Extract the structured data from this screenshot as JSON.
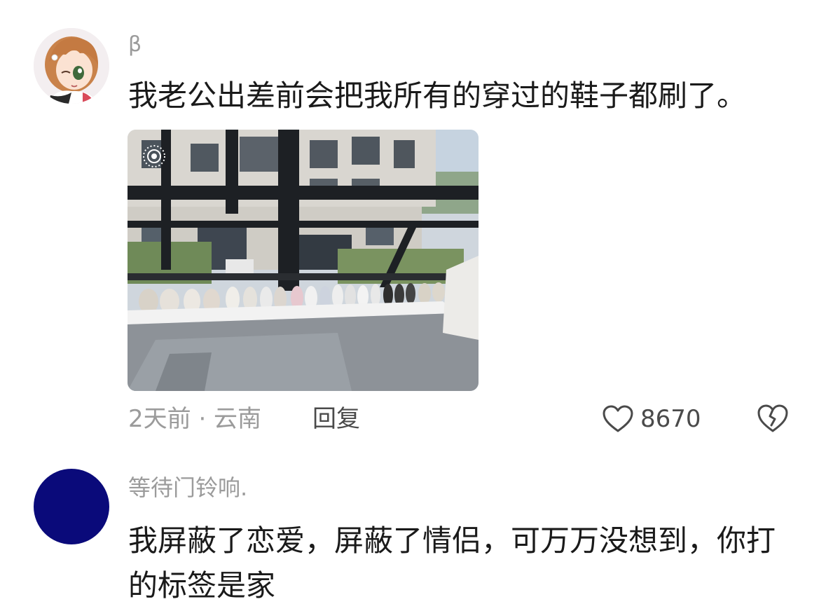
{
  "comments": [
    {
      "username": "β",
      "text": "我老公出差前会把我所有的穿过的鞋子都刷了。",
      "time_location": "2天前 · 云南",
      "reply_label": "回复",
      "likes": "8670",
      "has_photo": true
    },
    {
      "username": "等待门铃响.",
      "text": "我屏蔽了恋爱，屏蔽了情侣，可万万没想到，你打的标签是家"
    }
  ],
  "icons": {
    "like": "heart-outline-icon",
    "dislike": "broken-heart-icon"
  },
  "colors": {
    "username": "#9b9b9b",
    "body_text": "#1a1a1a",
    "meta_text": "#9b9b9b",
    "avatar2_bg": "#0a0a7a"
  }
}
